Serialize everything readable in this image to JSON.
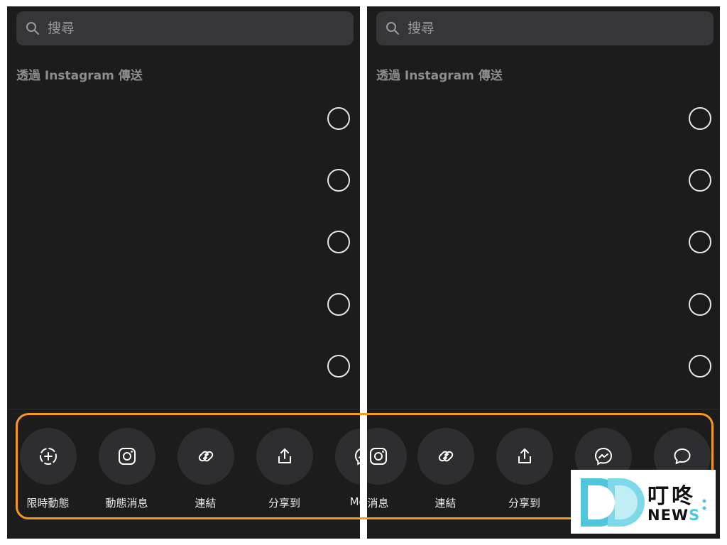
{
  "search": {
    "placeholder": "搜尋"
  },
  "section_title": "透過 Instagram 傳送",
  "left_share": [
    {
      "label": "限時動態",
      "icon": "story-add-icon"
    },
    {
      "label": "動態消息",
      "icon": "instagram-icon"
    },
    {
      "label": "連結",
      "icon": "link-icon"
    },
    {
      "label": "分享到",
      "icon": "share-upload-icon"
    },
    {
      "label": "Mess",
      "icon": "messenger-icon"
    }
  ],
  "right_share": [
    {
      "label": "消息",
      "icon": "instagram-icon"
    },
    {
      "label": "連結",
      "icon": "link-icon"
    },
    {
      "label": "分享到",
      "icon": "share-upload-icon"
    },
    {
      "label": "",
      "icon": "messenger-icon"
    },
    {
      "label": "",
      "icon": "chat-bubble-icon"
    }
  ],
  "watermark": {
    "cn": "叮咚",
    "en_main": "NEW",
    "en_accent": "S"
  },
  "colors": {
    "highlight": "#f39a1e",
    "panel_bg": "#1c1c1d",
    "brand_cyan": "#4fc6dc"
  }
}
